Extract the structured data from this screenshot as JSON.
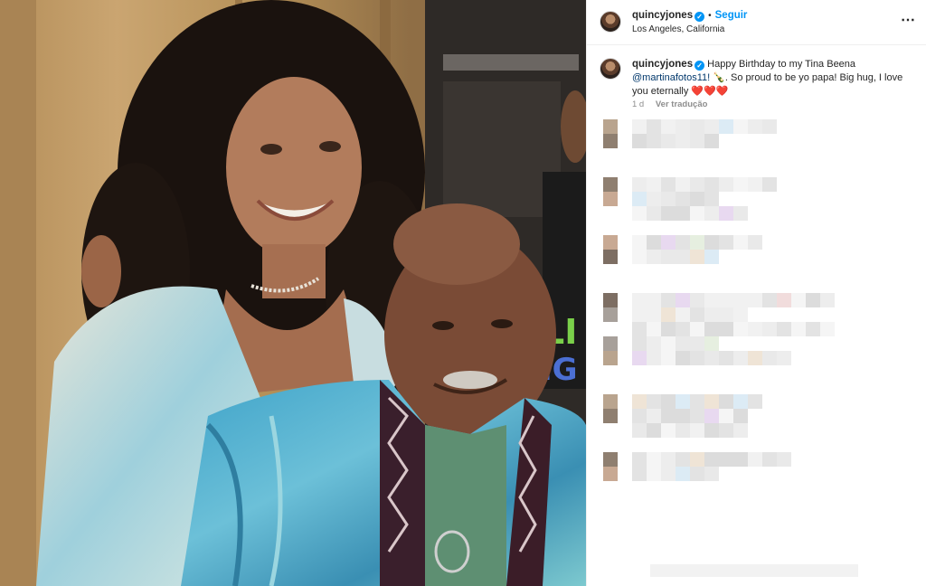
{
  "post": {
    "username": "quincyjones",
    "verified_mark": "✓",
    "separator": "•",
    "follow_label": "Seguir",
    "location": "Los Angeles, California",
    "more_icon": "⋯"
  },
  "caption": {
    "username": "quincyjones",
    "text_part1": "Happy Birthday to my Tina Beena",
    "mention": "@martinafotos11!",
    "text_part2": " 🍾. So proud to be yo papa! Big hug, I love you eternally ❤️❤️❤️",
    "time": "1 d",
    "translate_label": "Ver tradução"
  },
  "icons": {
    "avatar": "profile-avatar",
    "verified": "verified-badge-icon",
    "more": "more-options-icon"
  },
  "colors": {
    "accent": "#0095f6",
    "mention": "#00376b",
    "meta": "#8e8e8e"
  }
}
